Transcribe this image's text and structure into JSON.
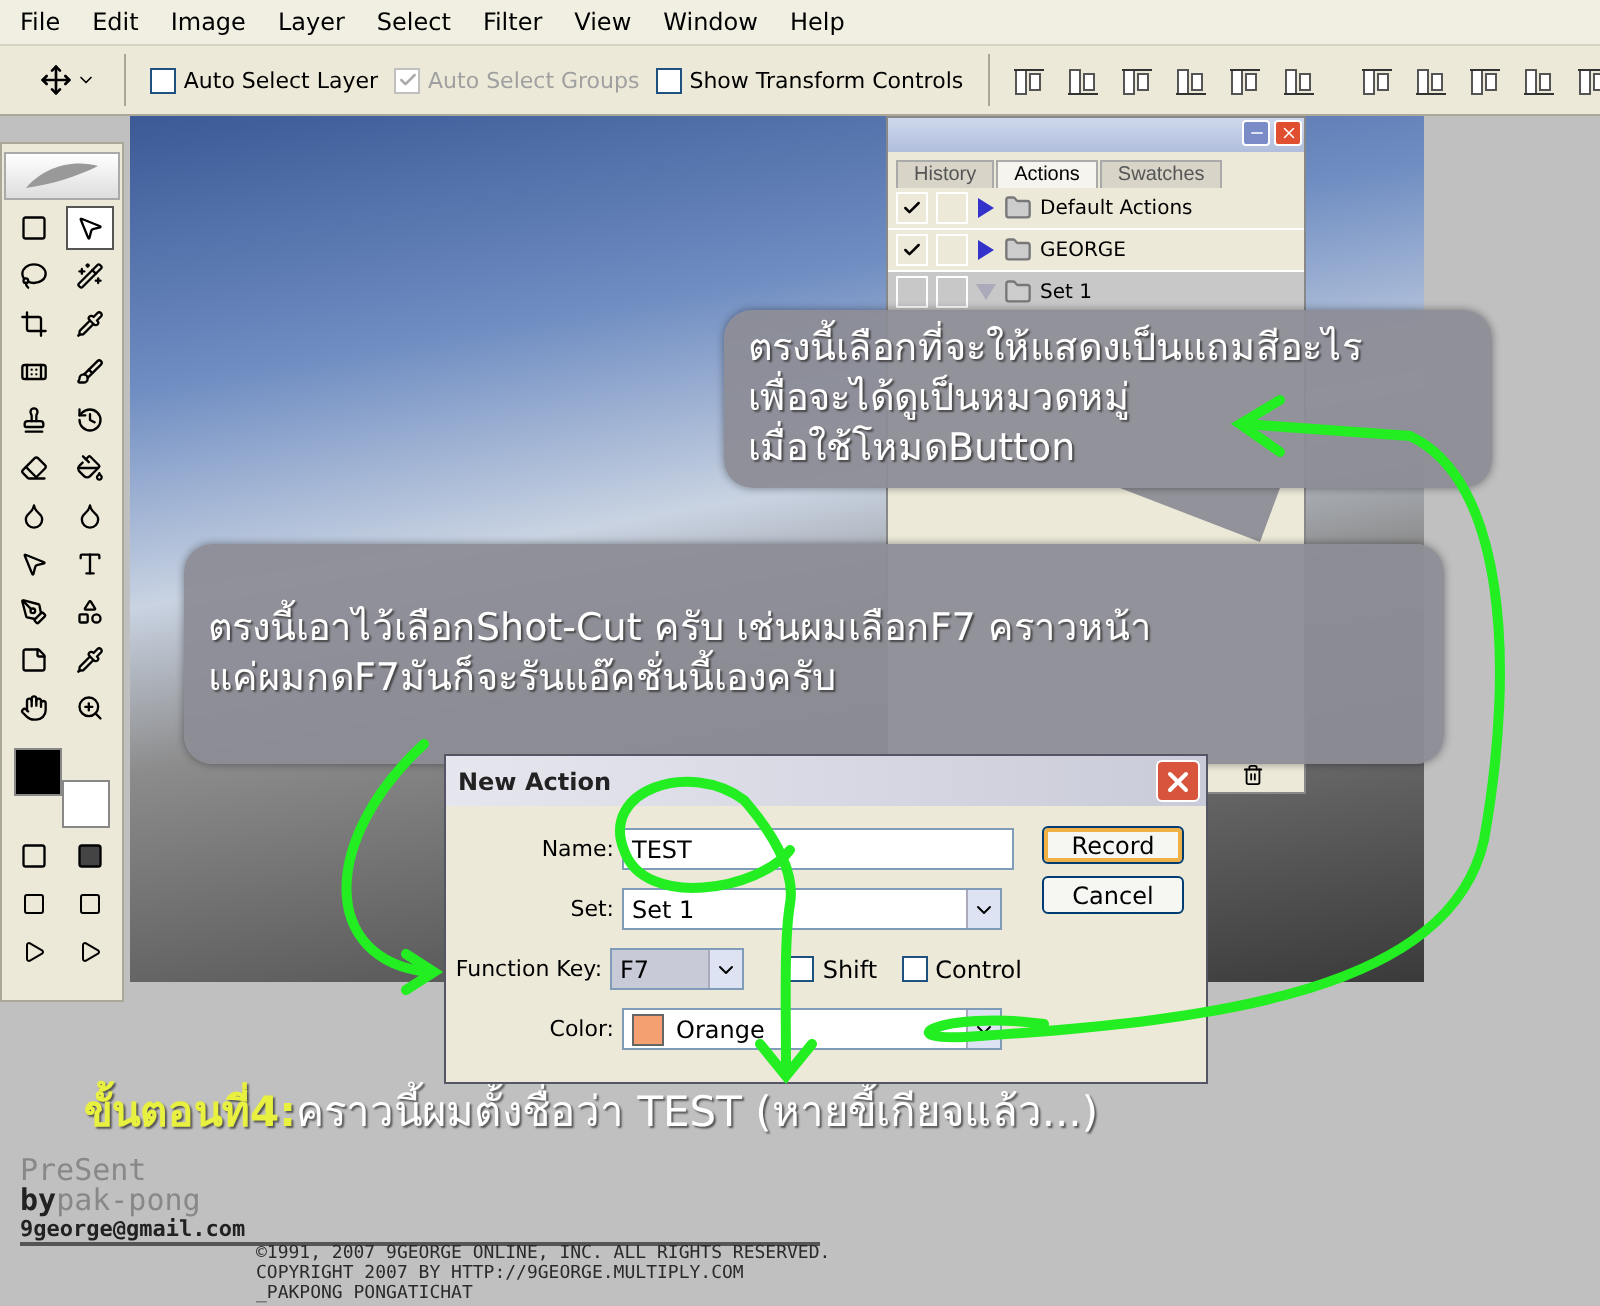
{
  "menu": [
    "File",
    "Edit",
    "Image",
    "Layer",
    "Select",
    "Filter",
    "View",
    "Window",
    "Help"
  ],
  "options_bar": {
    "checkboxes": [
      {
        "label": "Auto Select Layer",
        "checked": false,
        "disabled": false
      },
      {
        "label": "Auto Select Groups",
        "checked": true,
        "disabled": true
      },
      {
        "label": "Show Transform Controls",
        "checked": false,
        "disabled": false
      }
    ]
  },
  "actions_panel": {
    "tabs": [
      {
        "label": "History",
        "selected": false
      },
      {
        "label": "Actions",
        "selected": true
      },
      {
        "label": "Swatches",
        "selected": false
      }
    ],
    "rows": [
      {
        "label": "Default Actions",
        "checked": true,
        "expanded": false
      },
      {
        "label": "GEORGE",
        "checked": true,
        "expanded": false
      },
      {
        "label": "Set 1",
        "checked": false,
        "expanded": true
      }
    ]
  },
  "callouts": [
    {
      "lines": [
        "ตรงนี้เลือกที่จะให้แสดงเป็นแถมสีอะไร",
        "เพื่อจะได้ดูเป็นหมวดหมู่",
        "เมื่อใช้โหมดButton"
      ]
    },
    {
      "lines": [
        "ตรงนี้เอาไว้เลือกShot-Cut ครับ เช่นผมเลือกF7 คราวหน้า",
        "แค่ผมกดF7มันก็จะรันแอ๊คชั่นนี้เองครับ"
      ]
    }
  ],
  "dialog": {
    "title": "New Action",
    "fields": [
      {
        "kind": "text",
        "label": "Name:",
        "value": "TEST"
      },
      {
        "kind": "select",
        "label": "Set:",
        "value": "Set 1"
      },
      {
        "kind": "key",
        "label": "Function Key:",
        "value": "F7",
        "options": [
          {
            "label": "Shift",
            "checked": false
          },
          {
            "label": "Control",
            "checked": false
          }
        ]
      },
      {
        "kind": "color",
        "label": "Color:",
        "value": "Orange",
        "color": "#f4a070"
      }
    ],
    "buttons": [
      {
        "label": "Record",
        "default": true
      },
      {
        "label": "Cancel",
        "default": false
      }
    ]
  },
  "caption": {
    "step": "ขั้นตอนที่4:",
    "text": "คราวนี้ผมตั้งชื่อว่า TEST (หายขี้เกียจแล้ว...)"
  },
  "credits": {
    "present": "PreSent",
    "by": "by",
    "author": "pak-pong",
    "email": "9george@gmail.com",
    "copyright": [
      "©1991, 2007 9GEORGE ONLINE, INC. ALL RIGHTS RESERVED.",
      "COPYRIGHT 2007 BY  HTTP://9GEORGE.MULTIPLY.COM",
      "_PAKPONG PONGATICHAT"
    ]
  }
}
